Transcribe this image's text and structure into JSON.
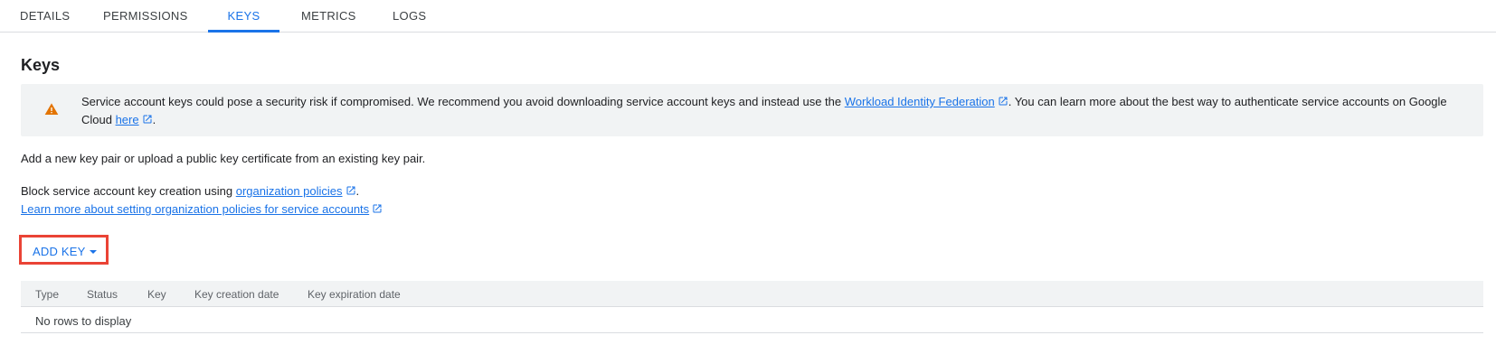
{
  "tabs": [
    {
      "label": "DETAILS",
      "active": false
    },
    {
      "label": "PERMISSIONS",
      "active": false
    },
    {
      "label": "KEYS",
      "active": true
    },
    {
      "label": "METRICS",
      "active": false
    },
    {
      "label": "LOGS",
      "active": false
    }
  ],
  "page_title": "Keys",
  "banner": {
    "icon": "warning-icon",
    "text_before": "Service account keys could pose a security risk if compromised. We recommend you avoid downloading service account keys and instead use the ",
    "link1": "Workload Identity Federation",
    "text_middle": ". You can learn more about the best way to authenticate service accounts on Google Cloud ",
    "link2": "here",
    "text_after": "."
  },
  "description": "Add a new key pair or upload a public key certificate from an existing key pair.",
  "block": {
    "text": "Block service account key creation using ",
    "link": "organization policies",
    "suffix": "."
  },
  "learn_more_link": "Learn more about setting organization policies for service accounts",
  "add_key_button": {
    "label": "ADD KEY"
  },
  "table": {
    "columns": [
      "Type",
      "Status",
      "Key",
      "Key creation date",
      "Key expiration date"
    ],
    "empty_message": "No rows to display"
  },
  "colors": {
    "accent": "#1a73e8",
    "highlight_border": "#ea4335",
    "warning": "#e37400"
  }
}
